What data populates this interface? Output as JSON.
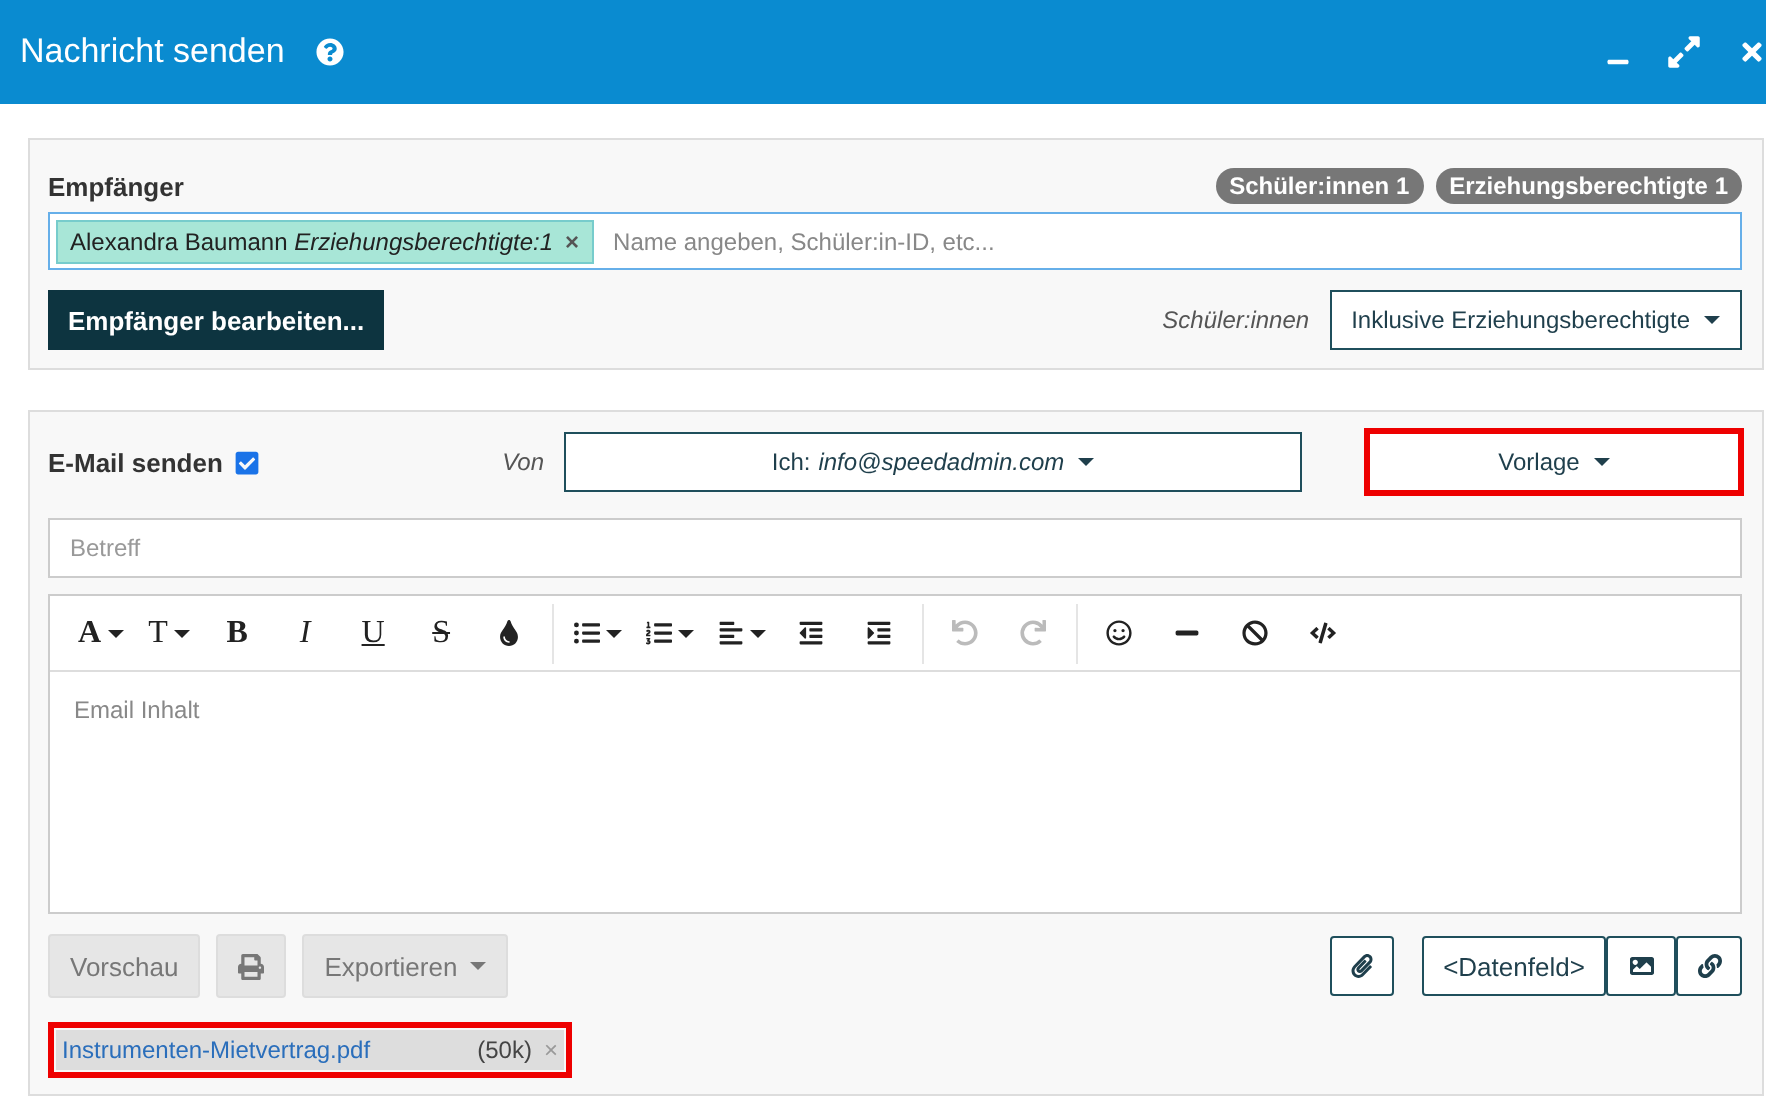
{
  "window": {
    "title": "Nachricht senden"
  },
  "recipients": {
    "label": "Empfänger",
    "counts": [
      "Schüler:innen 1",
      "Erziehungsberechtigte 1"
    ],
    "tokens": [
      {
        "name": "Alexandra Baumann",
        "role": "Erziehungsberechtigte:1",
        "remove": "×"
      }
    ],
    "placeholder": "Name angeben, Schüler:in-ID, etc...",
    "edit_button": "Empfänger bearbeiten...",
    "filter_label": "Schüler:innen",
    "filter_value": "Inklusive Erziehungsberechtigte"
  },
  "email": {
    "label": "E-Mail senden",
    "checked": true,
    "from_label": "Von",
    "from_prefix": "Ich:",
    "from_value": "info@speedadmin.com",
    "template": {
      "label": "Vorlage",
      "highlighted": true
    },
    "subject_placeholder": "Betreff",
    "body_placeholder": "Email Inhalt",
    "toolbar": [
      [
        {
          "kind": "font",
          "label": "A",
          "caret": true,
          "disabled": false
        },
        {
          "kind": "size",
          "label": "T",
          "caret": true,
          "disabled": false
        },
        {
          "kind": "bold",
          "label": "B",
          "caret": false,
          "disabled": false
        },
        {
          "kind": "italic",
          "label": "I",
          "caret": false,
          "disabled": false
        },
        {
          "kind": "underline",
          "label": "U",
          "caret": false,
          "disabled": false
        },
        {
          "kind": "strike",
          "label": "S",
          "caret": false,
          "disabled": false
        },
        {
          "kind": "color",
          "caret": false,
          "disabled": false
        }
      ],
      [
        {
          "kind": "bullets",
          "caret": true,
          "disabled": false
        },
        {
          "kind": "numbers",
          "caret": true,
          "disabled": false
        },
        {
          "kind": "align",
          "caret": true,
          "disabled": false
        },
        {
          "kind": "outdent",
          "caret": false,
          "disabled": false
        },
        {
          "kind": "indent",
          "caret": false,
          "disabled": false
        }
      ],
      [
        {
          "kind": "undo",
          "caret": false,
          "disabled": true
        },
        {
          "kind": "redo",
          "caret": false,
          "disabled": true
        }
      ],
      [
        {
          "kind": "emoji",
          "caret": false,
          "disabled": false
        },
        {
          "kind": "rule",
          "caret": false,
          "disabled": false
        },
        {
          "kind": "clear",
          "caret": false,
          "disabled": false
        },
        {
          "kind": "code",
          "caret": false,
          "disabled": false
        }
      ]
    ],
    "preview": "Vorschau",
    "export": "Exportieren",
    "datafield": "<Datenfeld>",
    "attachments": [
      {
        "name": "Instrumenten-Mietvertrag.pdf",
        "size": "(50k)",
        "remove": "×",
        "highlighted": true
      }
    ]
  }
}
